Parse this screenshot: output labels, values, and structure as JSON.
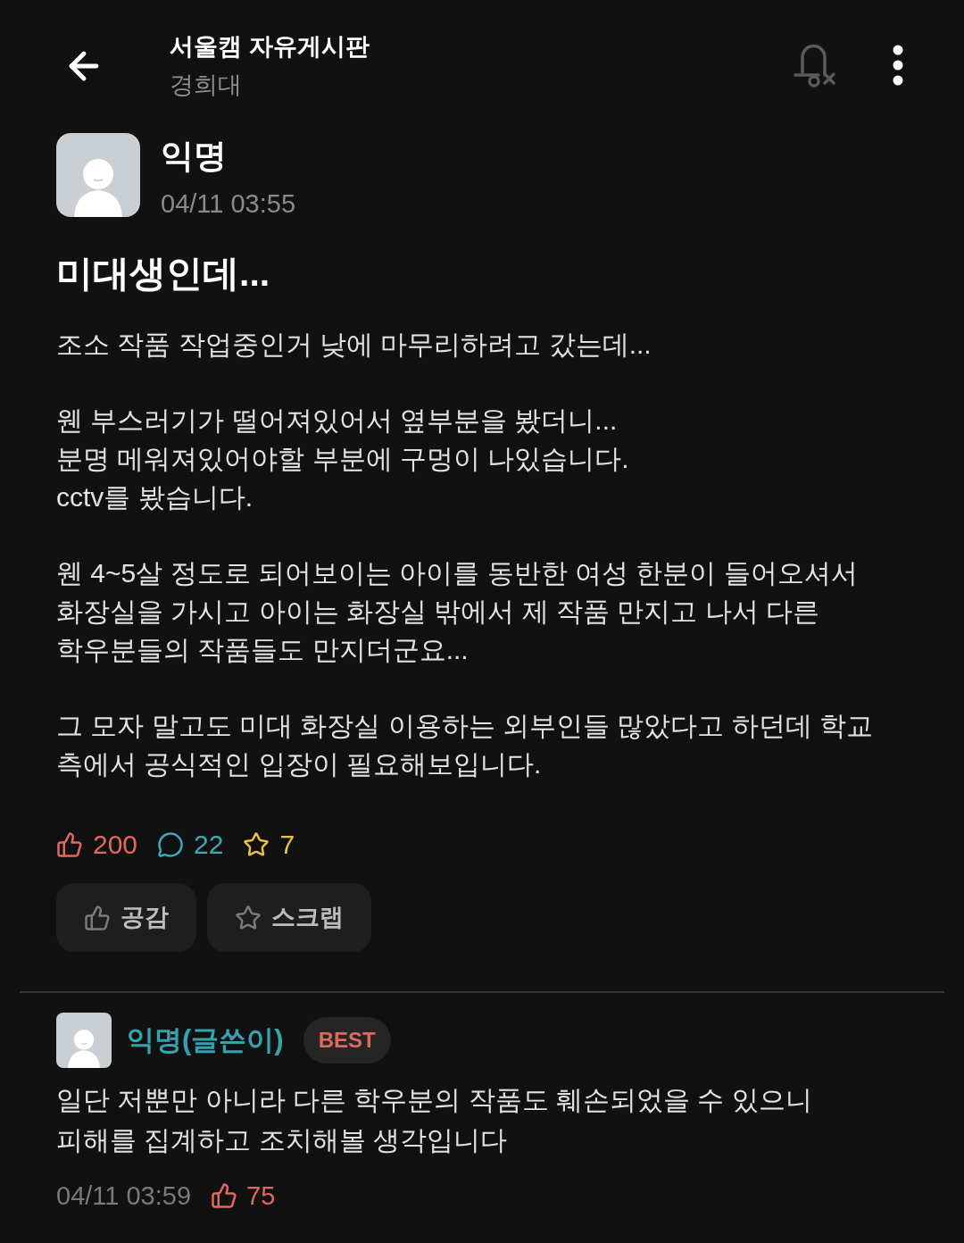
{
  "header": {
    "title": "서울캠 자유게시판",
    "subtitle": "경희대"
  },
  "post": {
    "author": "익명",
    "time": "04/11 03:55",
    "title": "미대생인데...",
    "body": [
      [
        "조소 작품 작업중인거 낮에 마무리하려고 갔는데..."
      ],
      [
        "웬 부스러기가 떨어져있어서 옆부분을 봤더니...",
        "분명 메워져있어야할 부분에 구멍이 나있습니다.",
        "cctv를 봤습니다."
      ],
      [
        "웬 4~5살 정도로 되어보이는 아이를 동반한 여성 한분이 들어오셔서",
        "화장실을 가시고 아이는 화장실 밖에서 제 작품 만지고 나서 다른",
        "학우분들의 작품들도 만지더군요..."
      ],
      [
        "그 모자 말고도 미대 화장실 이용하는 외부인들 많았다고 하던데 학교",
        "측에서 공식적인 입장이 필요해보입니다."
      ]
    ],
    "stats": [
      {
        "kind": "likes",
        "count": "200"
      },
      {
        "kind": "comments",
        "count": "22"
      },
      {
        "kind": "scraps",
        "count": "7"
      }
    ],
    "actions": [
      {
        "kind": "like",
        "label": "공감"
      },
      {
        "kind": "scrap",
        "label": "스크랩"
      }
    ]
  },
  "comments": [
    {
      "author": "익명(글쓴이)",
      "is_writer": true,
      "badge": "BEST",
      "text": [
        "일단 저뿐만 아니라 다른 학우분의 작품도 훼손되었을 수 있으니",
        "피해를 집계하고 조치해볼 생각입니다"
      ],
      "time": "04/11 03:59",
      "likes": "75"
    }
  ]
}
